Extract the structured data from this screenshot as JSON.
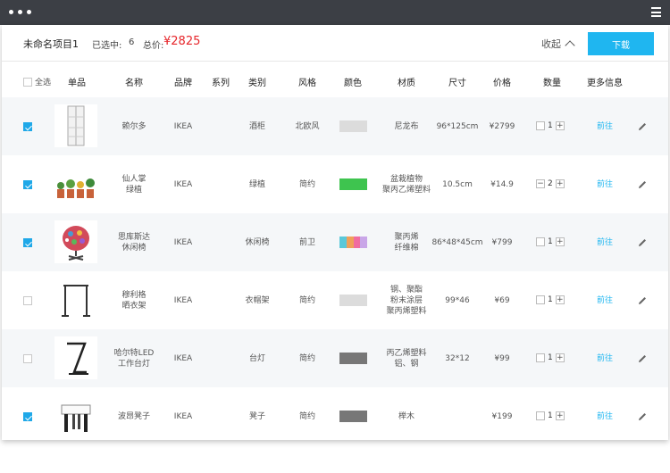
{
  "window": {
    "icons": [
      "three-dots-icon",
      "menu-icon"
    ]
  },
  "topbar": {
    "project_name": "未命名项目1",
    "selected_label": "已选中:",
    "selected_count": "6",
    "total_label": "总价:",
    "total_value": "¥2825",
    "collapse_label": "收起",
    "download_label": "下载"
  },
  "header": {
    "select_all": "全选",
    "item": "单品",
    "name": "名称",
    "brand": "品牌",
    "series": "系列",
    "category": "类别",
    "style": "风格",
    "color": "颜色",
    "material": "材质",
    "size": "尺寸",
    "price": "价格",
    "quantity": "数量",
    "more_info": "更多信息"
  },
  "rows": [
    {
      "checked": true,
      "thumb": "white-cabinet",
      "name": "赖尔多",
      "brand": "IKEA",
      "series": "",
      "category": "酒柜",
      "style": "北欧风",
      "colors": [
        "#dcdcdc"
      ],
      "material": "尼龙布",
      "size": "96*125cm",
      "price": "¥2799",
      "qty": "1",
      "more": "前往"
    },
    {
      "checked": true,
      "thumb": "potted-cacti",
      "name": "仙人掌\n绿植",
      "brand": "IKEA",
      "series": "",
      "category": "绿植",
      "style": "简约",
      "colors": [
        "#3ec44f"
      ],
      "material": "盆栽植物\n聚丙乙烯塑料",
      "size": "10.5cm",
      "price": "¥14.9",
      "qty": "2",
      "more": "前往"
    },
    {
      "checked": true,
      "thumb": "patterned-chair",
      "name": "思库斯达\n休闲椅",
      "brand": "IKEA",
      "series": "",
      "category": "休闲椅",
      "style": "前卫",
      "colors": [
        "#5bc8d9",
        "#f0a05a",
        "#f06ca0",
        "#c9a6e8"
      ],
      "material": "聚丙烯\n纤维棉",
      "size": "86*48*45cm",
      "price": "¥799",
      "qty": "1",
      "more": "前往"
    },
    {
      "checked": false,
      "thumb": "clothes-rack",
      "name": "穆利格\n晒衣架",
      "brand": "IKEA",
      "series": "",
      "category": "衣帽架",
      "style": "简约",
      "colors": [
        "#dcdcdc"
      ],
      "material": "钢、聚酯\n粉末涂层\n聚丙烯塑料",
      "size": "99*46",
      "price": "¥69",
      "qty": "1",
      "more": "前往"
    },
    {
      "checked": false,
      "thumb": "desk-lamp",
      "name": "哈尔特LED\n工作台灯",
      "brand": "IKEA",
      "series": "",
      "category": "台灯",
      "style": "简约",
      "colors": [
        "#777777"
      ],
      "material": "丙乙烯塑料\n铝、钢",
      "size": "32*12",
      "price": "¥99",
      "qty": "1",
      "more": "前往"
    },
    {
      "checked": true,
      "thumb": "stool",
      "name": "波昂凳子",
      "brand": "IKEA",
      "series": "",
      "category": "凳子",
      "style": "简约",
      "colors": [
        "#777777"
      ],
      "material": "榉木",
      "size": "",
      "price": "¥199",
      "qty": "1",
      "more": "前往"
    }
  ]
}
